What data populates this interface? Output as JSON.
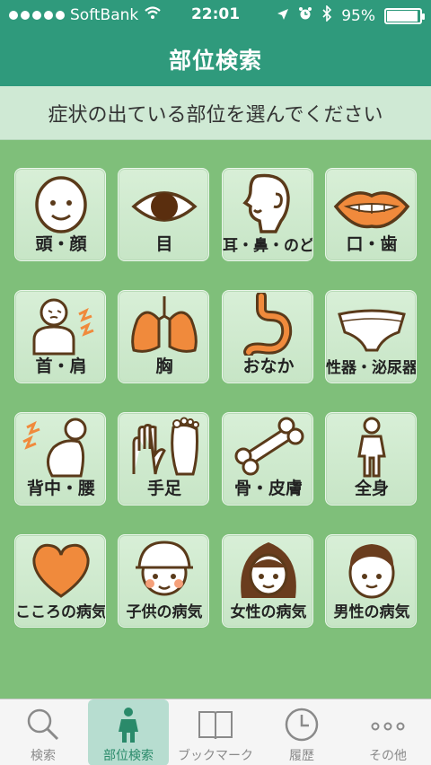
{
  "status_bar": {
    "carrier": "SoftBank",
    "time": "22:01",
    "battery_text": "95%",
    "battery_level": 0.95,
    "icons": [
      "signal-dots-icon",
      "wifi-icon",
      "location-arrow-icon",
      "alarm-icon",
      "bluetooth-icon",
      "battery-icon"
    ]
  },
  "header": {
    "title": "部位検索"
  },
  "instruction": {
    "text": "症状の出ている部位を選んでください"
  },
  "body_parts": [
    {
      "label": "頭・顔",
      "icon": "head-face-icon"
    },
    {
      "label": "目",
      "icon": "eye-icon"
    },
    {
      "label": "耳・鼻・のど",
      "icon": "ear-nose-throat-icon"
    },
    {
      "label": "口・歯",
      "icon": "mouth-teeth-icon"
    },
    {
      "label": "首・肩",
      "icon": "neck-shoulder-icon"
    },
    {
      "label": "胸",
      "icon": "lungs-icon"
    },
    {
      "label": "おなか",
      "icon": "stomach-icon"
    },
    {
      "label": "性器・泌尿器",
      "icon": "underwear-icon"
    },
    {
      "label": "背中・腰",
      "icon": "back-waist-icon"
    },
    {
      "label": "手足",
      "icon": "hand-foot-icon"
    },
    {
      "label": "骨・皮膚",
      "icon": "bone-icon"
    },
    {
      "label": "全身",
      "icon": "whole-body-icon"
    },
    {
      "label": "こころの病気",
      "icon": "heart-icon"
    },
    {
      "label": "子供の病気",
      "icon": "child-icon"
    },
    {
      "label": "女性の病気",
      "icon": "woman-icon"
    },
    {
      "label": "男性の病気",
      "icon": "man-icon"
    }
  ],
  "tabs": [
    {
      "label": "検索",
      "icon": "search-icon",
      "active": false
    },
    {
      "label": "部位検索",
      "icon": "body-figure-icon",
      "active": true
    },
    {
      "label": "ブックマーク",
      "icon": "book-icon",
      "active": false
    },
    {
      "label": "履歴",
      "icon": "clock-icon",
      "active": false
    },
    {
      "label": "その他",
      "icon": "more-dots-icon",
      "active": false
    }
  ],
  "colors": {
    "header": "#2f9a7c",
    "background": "#7fbf7a",
    "instruction_bg": "#cfe9d4",
    "tile_bg": "#d3ecd2",
    "accent_orange": "#f08a3c",
    "active_tab": "#2a8a6a"
  }
}
